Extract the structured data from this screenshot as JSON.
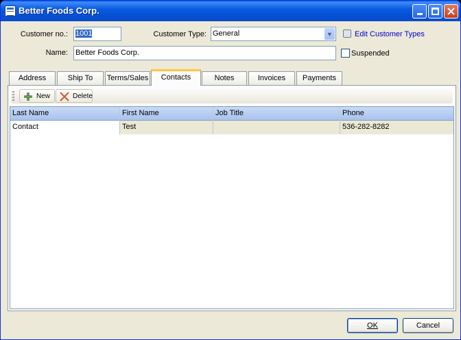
{
  "window": {
    "title": "Better Foods Corp."
  },
  "form": {
    "customer_no_label": "Customer no.:",
    "customer_no_value": "1001",
    "customer_type_label": "Customer Type:",
    "customer_type_value": "General",
    "edit_types_link": "Edit Customer Types",
    "name_label": "Name:",
    "name_value": "Better Foods Corp.",
    "suspended_label": "Suspended",
    "suspended_checked": false
  },
  "tabs": [
    {
      "label": "Address"
    },
    {
      "label": "Ship To"
    },
    {
      "label": "Terms/Sales"
    },
    {
      "label": "Contacts",
      "active": true
    },
    {
      "label": "Notes"
    },
    {
      "label": "Invoices"
    },
    {
      "label": "Payments"
    }
  ],
  "toolbar": {
    "new_label": "New",
    "delete_label": "Delete"
  },
  "grid": {
    "columns": [
      "Last Name",
      "First Name",
      "Job Title",
      "Phone"
    ],
    "rows": [
      [
        "Contact",
        "Test",
        "",
        "536-282-8282"
      ]
    ]
  },
  "buttons": {
    "ok_label": "OK",
    "cancel_label": "Cancel"
  },
  "colors": {
    "title_bar": "#0552d6",
    "dialog_bg": "#ece9d8",
    "active_tab_accent": "#ffc83c",
    "link": "#0000cc",
    "selection": "#316ac5"
  }
}
